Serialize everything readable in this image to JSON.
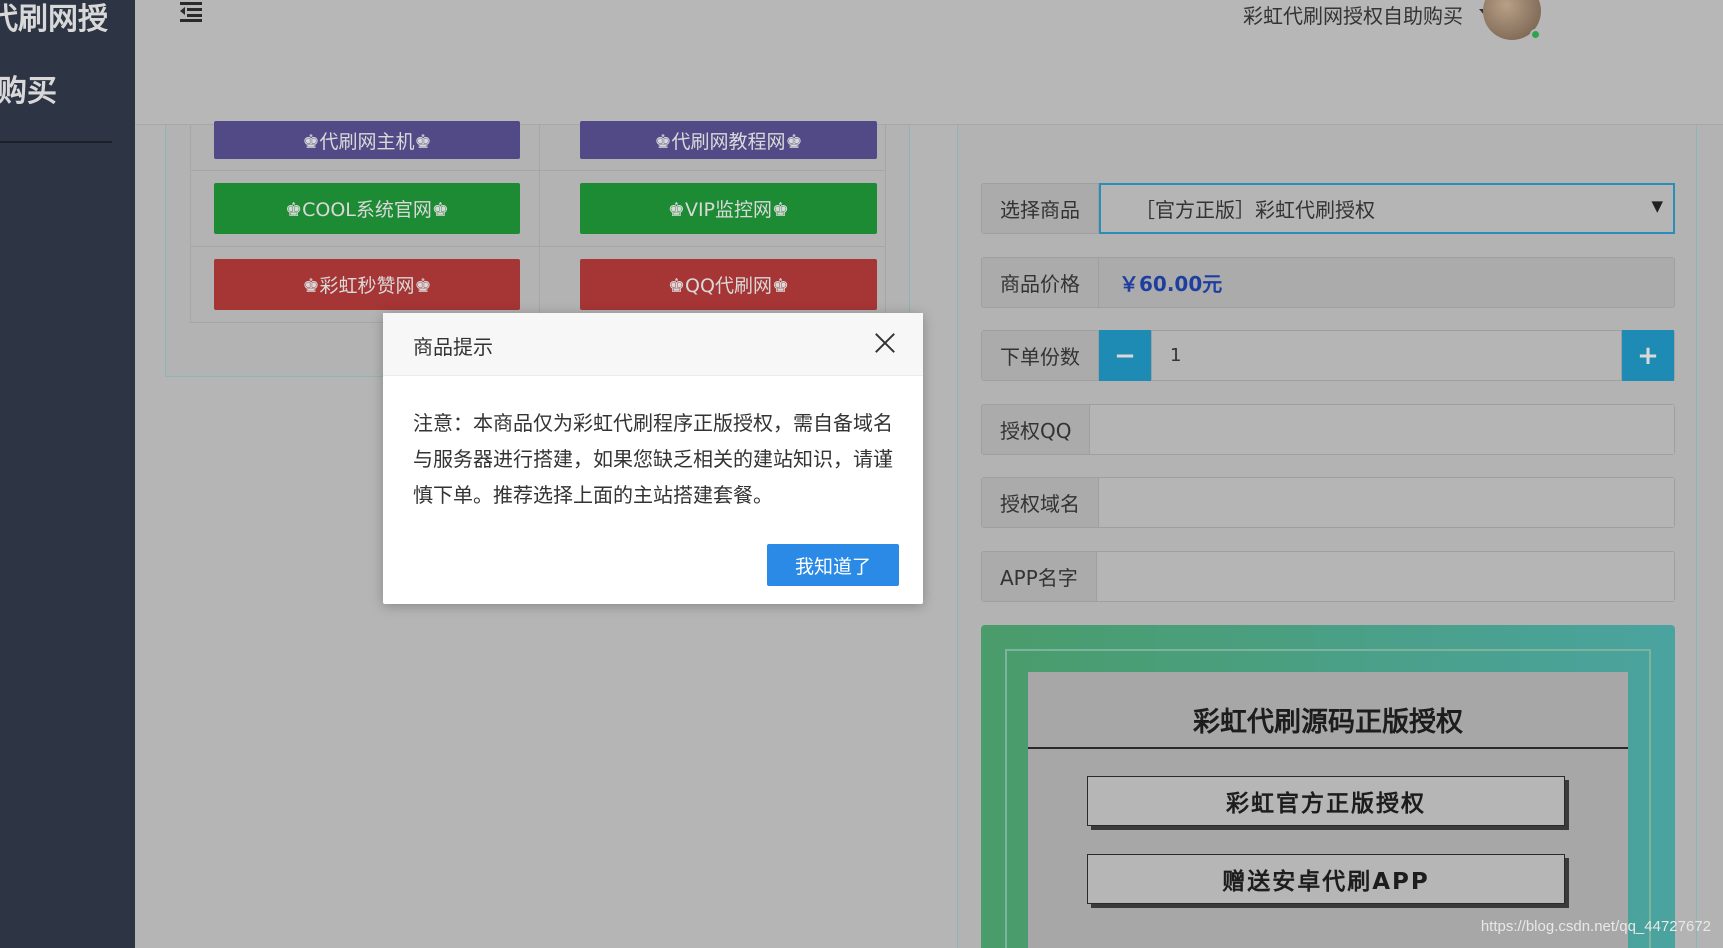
{
  "sidebar": {
    "title_line1": "代刷网授",
    "title_line2": "购买"
  },
  "header": {
    "user_name": "彩虹代刷网授权自助购买"
  },
  "links": [
    {
      "label": "♚代刷网主机♚",
      "color": "#524a86"
    },
    {
      "label": "♚代刷网教程网♚",
      "color": "#524a86"
    },
    {
      "label": "♚COOL系统官网♚",
      "color": "#1d8a34"
    },
    {
      "label": "♚VIP监控网♚",
      "color": "#1d8a34"
    },
    {
      "label": "♚彩虹秒赞网♚",
      "color": "#a63535"
    },
    {
      "label": "♚QQ代刷网♚",
      "color": "#a63535"
    }
  ],
  "form": {
    "product_label": "选择商品",
    "product_value": "［官方正版］彩虹代刷授权",
    "price_label": "商品价格",
    "price_value": "￥60.00元",
    "qty_label": "下单份数",
    "qty_minus": "−",
    "qty_value": "1",
    "qty_plus": "+",
    "qq_label": "授权QQ",
    "domain_label": "授权域名",
    "app_label": "APP名字"
  },
  "promo": {
    "title": "彩虹代刷源码正版授权",
    "badges": [
      "彩虹官方正版授权",
      "赠送安卓代刷APP"
    ]
  },
  "modal": {
    "title": "商品提示",
    "body": "注意：本商品仅为彩虹代刷程序正版授权，需自备域名与服务器进行搭建，如果您缺乏相关的建站知识，请谨慎下单。推荐选择上面的主站搭建套餐。",
    "ok_label": "我知道了"
  },
  "watermark": "https://blog.csdn.net/qq_44727672",
  "colors": {
    "accent_blue": "#2a8ae6",
    "qty_button": "#1e8bb4",
    "price_text": "#1f3fa0"
  }
}
